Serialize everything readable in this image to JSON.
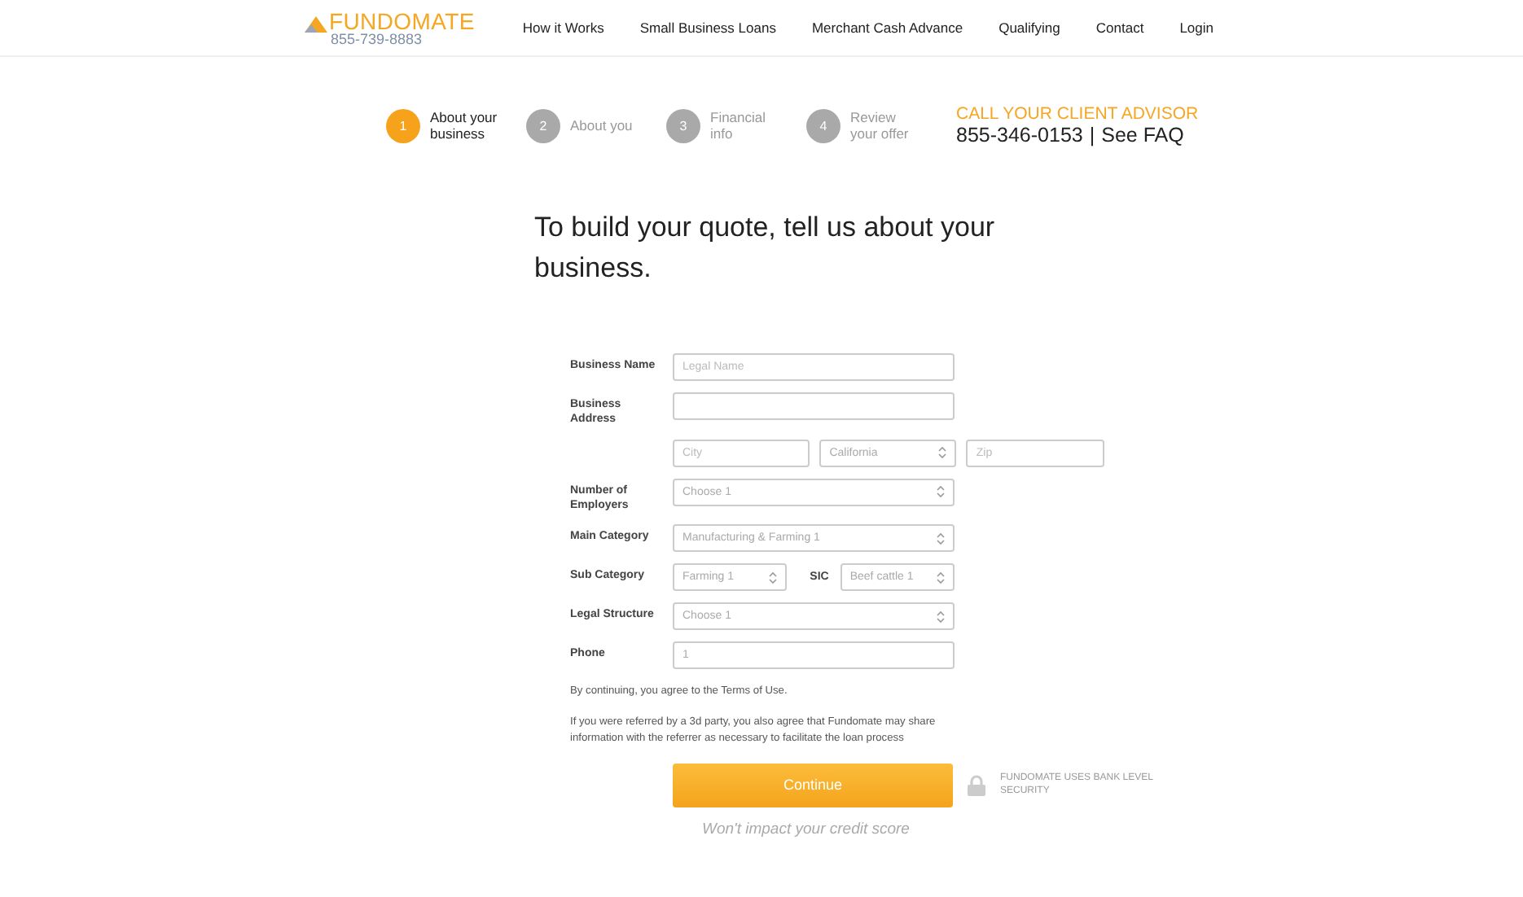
{
  "header": {
    "logo": "FUNDOMATE",
    "phone": "855-739-8883",
    "nav": [
      "How it Works",
      "Small Business Loans",
      "Merchant Cash Advance",
      "Qualifying",
      "Contact",
      "Login"
    ]
  },
  "steps": [
    {
      "number": "1",
      "label": "About your business",
      "selected": true
    },
    {
      "number": "2",
      "label": "About you",
      "selected": false
    },
    {
      "number": "3",
      "label": "Financial info",
      "selected": false
    },
    {
      "number": "4",
      "label": "Review your offer",
      "selected": false
    }
  ],
  "advisor": {
    "title": "CALL YOUR CLIENT ADVISOR",
    "phone": "855-346-0153",
    "separator": "|",
    "link": "See FAQ"
  },
  "heading": "To build your quote, tell us about your business.",
  "form": [
    {
      "label": "Business Name",
      "fields": [
        {
          "kind": "input",
          "placeholder": "Legal Name"
        }
      ]
    },
    {
      "label": "Business Address",
      "fields": [
        {
          "kind": "input"
        }
      ]
    },
    {
      "fields": [
        {
          "kind": "input",
          "placeholder": "City"
        },
        {
          "kind": "select",
          "value": "California"
        },
        {
          "kind": "input",
          "placeholder": "Zip"
        }
      ]
    },
    {
      "label": "Number of Employers",
      "fields": [
        {
          "kind": "select",
          "value": "Choose 1"
        }
      ]
    },
    {
      "label": "Main Category",
      "fields": [
        {
          "kind": "select",
          "value": "Manufacturing & Farming 1"
        }
      ]
    },
    {
      "label": "Sub Category",
      "fields": [
        {
          "kind": "select",
          "value": "Farming 1"
        },
        {
          "kind": "select",
          "label": "SIC",
          "value": "Beef cattle 1"
        }
      ]
    },
    {
      "label": "Legal Structure",
      "fields": [
        {
          "kind": "select",
          "value": "Choose 1"
        }
      ]
    },
    {
      "label": "Phone",
      "fields": [
        {
          "kind": "input",
          "value": "1"
        }
      ]
    }
  ],
  "notes": [
    "By continuing, you agree to the Terms of Use.",
    "If you were referred by a 3d party, you also agree that Fundomate may share information with the referrer as necessary to facilitate the loan process"
  ],
  "continue": "Continue",
  "security": "FUNDOMATE USES BANK LEVEL SECURITY",
  "footnote": "Won't impact your credit score"
}
